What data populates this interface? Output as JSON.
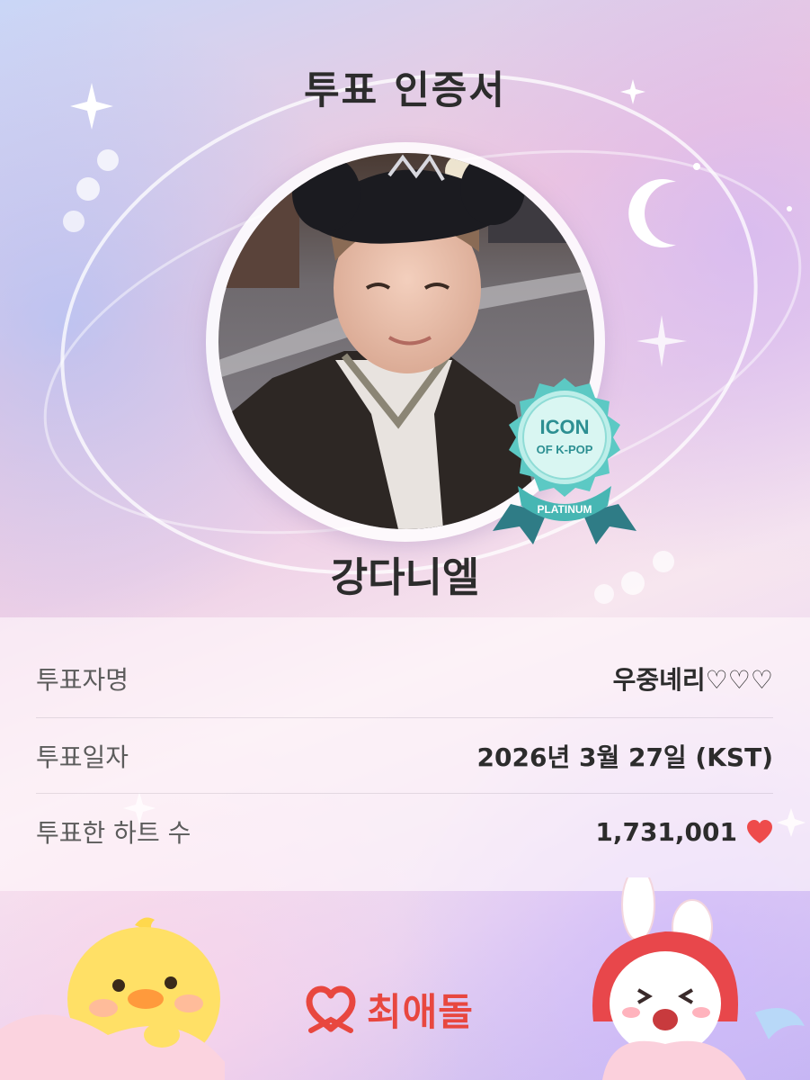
{
  "certificate": {
    "title": "투표 인증서",
    "idol_name": "강다니엘",
    "badge": {
      "line1": "ICON",
      "line2": "OF K-POP",
      "tier": "PLATINUM",
      "color": "#5cc9c4"
    }
  },
  "info": {
    "rows": [
      {
        "label": "투표자명",
        "value": "우중녜리♡♡♡"
      },
      {
        "label": "투표일자",
        "value": "2026년 3월 27일 (KST)"
      },
      {
        "label": "투표한 하트 수",
        "value": "1,731,001"
      }
    ],
    "heart_color": "#ee4b4b"
  },
  "brand": {
    "name": "최애돌",
    "color": "#e8473f"
  },
  "icons": [
    "sparkle-icon",
    "moon-icon",
    "heart-icon",
    "brand-logo-icon",
    "badge-icon"
  ]
}
